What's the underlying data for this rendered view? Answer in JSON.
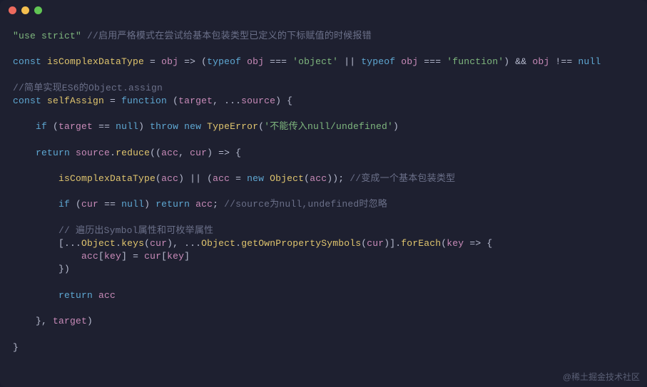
{
  "window": {
    "traffic_lights": {
      "close": "#ed6a5e",
      "minimize": "#f4bf4f",
      "maximize": "#61c554"
    }
  },
  "code": {
    "l1_str": "\"use strict\"",
    "l1_com": " //启用严格模式在尝试给基本包装类型已定义的下标赋值的时候报错",
    "l3_kw_const": "const",
    "l3_fn_name": " isComplexDataType",
    "l3_eq": " = ",
    "l3_arg": "obj",
    "l3_arrow": " => ",
    "l3_p1": "(",
    "l3_kw_typeof1": "typeof",
    "l3_sp": " ",
    "l3_obj1": "obj",
    "l3_eqq1": " === ",
    "l3_str_obj": "'object'",
    "l3_or": " || ",
    "l3_kw_typeof2": "typeof",
    "l3_obj2": "obj",
    "l3_eqq2": " === ",
    "l3_str_fn": "'function'",
    "l3_p2": ")",
    "l3_and": " && ",
    "l3_obj3": "obj",
    "l3_neq": " !== ",
    "l3_null": "null",
    "l5_com": "//简单实现ES6的Object.assign",
    "l6_kw_const": "const",
    "l6_fn_name": " selfAssign",
    "l6_eq": " = ",
    "l6_kw_function": "function",
    "l6_p1": " (",
    "l6_arg1": "target",
    "l6_comma": ", ",
    "l6_spread": "...",
    "l6_arg2": "source",
    "l6_p2": ") {",
    "l8_indent": "    ",
    "l8_kw_if": "if",
    "l8_p1": " (",
    "l8_target": "target",
    "l8_eqeq": " == ",
    "l8_null": "null",
    "l8_p2": ") ",
    "l8_kw_throw": "throw",
    "l8_sp": " ",
    "l8_kw_new": "new",
    "l8_sp2": " ",
    "l8_type": "TypeError",
    "l8_p3": "(",
    "l8_str": "'不能传入null/undefined'",
    "l8_p4": ")",
    "l10_indent": "    ",
    "l10_kw_return": "return",
    "l10_sp": " ",
    "l10_src": "source",
    "l10_dot": ".",
    "l10_reduce": "reduce",
    "l10_p1": "((",
    "l10_acc": "acc",
    "l10_comma": ", ",
    "l10_cur": "cur",
    "l10_p2": ") => {",
    "l12_indent": "        ",
    "l12_fn": "isComplexDataType",
    "l12_p1": "(",
    "l12_acc": "acc",
    "l12_p2": ") || (",
    "l12_acc2": "acc",
    "l12_eq": " = ",
    "l12_kw_new": "new",
    "l12_sp": " ",
    "l12_obj": "Object",
    "l12_p3": "(",
    "l12_acc3": "acc",
    "l12_p4": ")); ",
    "l12_com": "//变成一个基本包装类型",
    "l14_indent": "        ",
    "l14_kw_if": "if",
    "l14_p1": " (",
    "l14_cur": "cur",
    "l14_eqeq": " == ",
    "l14_null": "null",
    "l14_p2": ") ",
    "l14_kw_return": "return",
    "l14_sp": " ",
    "l14_acc": "acc",
    "l14_semi": "; ",
    "l14_com": "//source为null,undefined时忽略",
    "l16_indent": "        ",
    "l16_com": "// 遍历出Symbol属性和可枚举属性",
    "l17_indent": "        ",
    "l17_b1": "[",
    "l17_spread1": "...",
    "l17_obj1": "Object",
    "l17_dot1": ".",
    "l17_keys": "keys",
    "l17_p1": "(",
    "l17_cur1": "cur",
    "l17_p2": "), ",
    "l17_spread2": "...",
    "l17_obj2": "Object",
    "l17_dot2": ".",
    "l17_sym": "getOwnPropertySymbols",
    "l17_p3": "(",
    "l17_cur2": "cur",
    "l17_p4": ")].",
    "l17_foreach": "forEach",
    "l17_p5": "(",
    "l17_key": "key",
    "l17_arrow": " => {",
    "l18_indent": "            ",
    "l18_acc": "acc",
    "l18_b1": "[",
    "l18_key1": "key",
    "l18_b2": "] = ",
    "l18_cur": "cur",
    "l18_b3": "[",
    "l18_key2": "key",
    "l18_b4": "]",
    "l19_indent": "        ",
    "l19_close": "})",
    "l21_indent": "        ",
    "l21_kw_return": "return",
    "l21_sp": " ",
    "l21_acc": "acc",
    "l23_indent": "    ",
    "l23_close": "}, ",
    "l23_target": "target",
    "l23_p": ")",
    "l25_close": "}"
  },
  "watermark": "@稀土掘金技术社区"
}
